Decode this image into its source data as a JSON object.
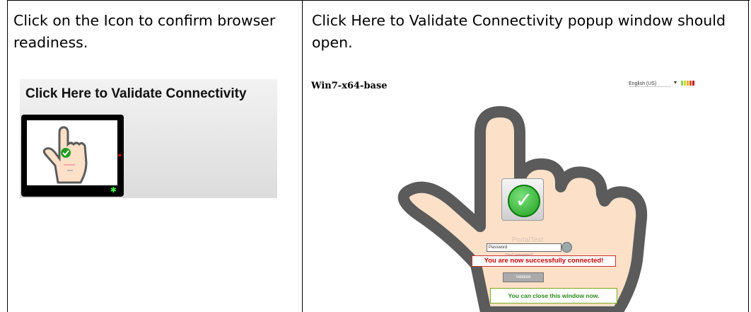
{
  "left_cell": {
    "instruction": "Click on the Icon to confirm browser readiness.",
    "screenshot": {
      "title": "Click Here to Validate Connectivity",
      "icon": "hand-pointer-icon"
    }
  },
  "right_cell": {
    "instruction": "Click Here to Validate Connectivity popup window should open.",
    "popup": {
      "window_title": "Win7-x64-base",
      "language": "English (US)",
      "portal_title": "PortalText",
      "password_placeholder": "Password",
      "forgot_text": "Don't remember?",
      "success_message": "You are now successfully connected!",
      "button_label": "Validate",
      "close_message": "You can close this window now.",
      "colors": {
        "hand_fill": "#fde0c8",
        "hand_outline": "#5b5b5b",
        "check_green": "#20a020",
        "error_red": "#cc0000"
      }
    }
  }
}
